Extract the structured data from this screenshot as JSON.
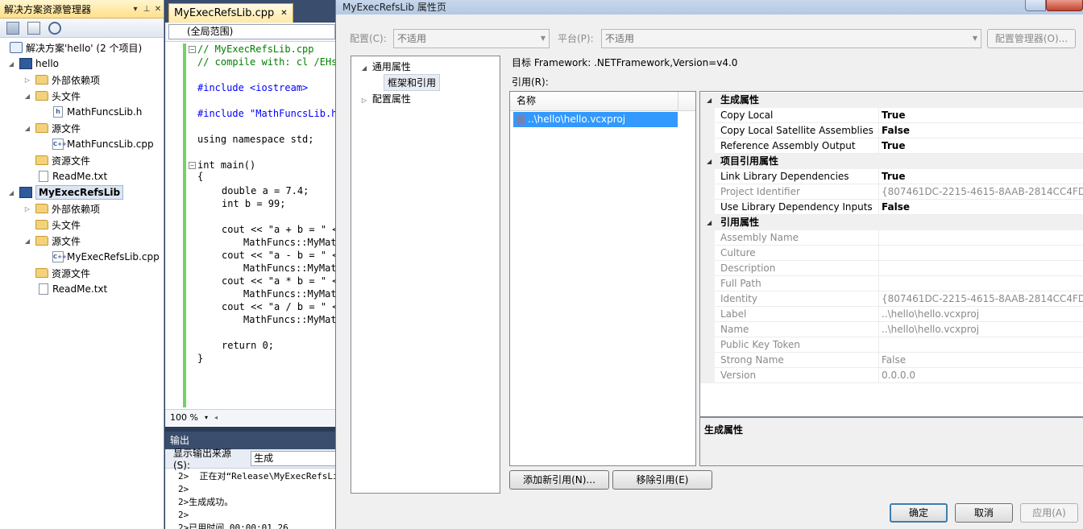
{
  "solution_explorer": {
    "title": "解决方案资源管理器",
    "tree": [
      {
        "label": "解决方案'hello' (2 个项目)",
        "kind": "solution"
      },
      {
        "label": "hello",
        "kind": "project"
      },
      {
        "label": "外部依赖项",
        "kind": "folder"
      },
      {
        "label": "头文件",
        "kind": "folder"
      },
      {
        "label": "MathFuncsLib.h",
        "kind": "header"
      },
      {
        "label": "源文件",
        "kind": "folder"
      },
      {
        "label": "MathFuncsLib.cpp",
        "kind": "cpp"
      },
      {
        "label": "资源文件",
        "kind": "folder"
      },
      {
        "label": "ReadMe.txt",
        "kind": "file"
      },
      {
        "label": "MyExecRefsLib",
        "kind": "project"
      },
      {
        "label": "外部依赖项",
        "kind": "folder"
      },
      {
        "label": "头文件",
        "kind": "folder"
      },
      {
        "label": "源文件",
        "kind": "folder"
      },
      {
        "label": "MyExecRefsLib.cpp",
        "kind": "cpp"
      },
      {
        "label": "资源文件",
        "kind": "folder"
      },
      {
        "label": "ReadMe.txt",
        "kind": "file"
      }
    ]
  },
  "editor": {
    "tab_label": "MyExecRefsLib.cpp",
    "scope": "(全局范围)",
    "zoom": "100 %",
    "lines": [
      "// MyExecRefsLib.cpp",
      "// compile with: cl /EHs",
      "#include <iostream>",
      "#include \"MathFuncsLib.h",
      "using namespace std;",
      "int main()",
      "{",
      "double a = 7.4;",
      "int b = 99;",
      "cout << \"a + b = \" <",
      "MathFuncs::MyMat",
      "cout << \"a - b = \" <",
      "MathFuncs::MyMat",
      "cout << \"a * b = \" <",
      "MathFuncs::MyMat",
      "cout << \"a / b = \" <",
      "MathFuncs::MyMat",
      "return 0;",
      "}"
    ]
  },
  "output": {
    "title": "输出",
    "source_label": "显示输出来源(S):",
    "source_value": "生成",
    "lines": [
      "2>  正在对“Release\\MyExecRefsLil",
      "2>",
      "2>生成成功。",
      "2>",
      "2>已用时间 00:00:01.26"
    ]
  },
  "dialog": {
    "title": "MyExecRefsLib 属性页",
    "config_label": "配置(C):",
    "config_value": "不适用",
    "platform_label": "平台(P):",
    "platform_value": "不适用",
    "config_manager": "配置管理器(O)...",
    "nav": {
      "common": "通用属性",
      "framework": "框架和引用",
      "config": "配置属性"
    },
    "framework_text": "目标 Framework:  .NETFramework,Version=v4.0",
    "refs_label": "引用(R):",
    "list_header": "名称",
    "list_item": "..\\hello\\hello.vcxproj",
    "add_ref": "添加新引用(N)...",
    "remove_ref": "移除引用(E)",
    "ok": "确定",
    "cancel": "取消",
    "apply": "应用(A)",
    "desc_title": "生成属性",
    "properties": [
      {
        "type": "cat",
        "k": "生成属性"
      },
      {
        "type": "row",
        "k": "Copy Local",
        "v": "True",
        "style": "bold"
      },
      {
        "type": "row",
        "k": "Copy Local Satellite Assemblies",
        "v": "False",
        "style": "bold"
      },
      {
        "type": "row",
        "k": "Reference Assembly Output",
        "v": "True",
        "style": "bold"
      },
      {
        "type": "cat",
        "k": "项目引用属性"
      },
      {
        "type": "row",
        "k": "Link Library Dependencies",
        "v": "True",
        "style": "bold"
      },
      {
        "type": "row",
        "k": "Project Identifier",
        "v": "{807461DC-2215-4615-8AAB-2814CC4FD",
        "style": "gray"
      },
      {
        "type": "row",
        "k": "Use Library Dependency Inputs",
        "v": "False",
        "style": "bold"
      },
      {
        "type": "cat",
        "k": "引用属性"
      },
      {
        "type": "row",
        "k": "Assembly Name",
        "v": "",
        "style": "gray"
      },
      {
        "type": "row",
        "k": "Culture",
        "v": "",
        "style": "gray"
      },
      {
        "type": "row",
        "k": "Description",
        "v": "",
        "style": "gray"
      },
      {
        "type": "row",
        "k": "Full Path",
        "v": "",
        "style": "gray"
      },
      {
        "type": "row",
        "k": "Identity",
        "v": "{807461DC-2215-4615-8AAB-2814CC4FD",
        "style": "gray"
      },
      {
        "type": "row",
        "k": "Label",
        "v": "..\\hello\\hello.vcxproj",
        "style": "gray"
      },
      {
        "type": "row",
        "k": "Name",
        "v": "..\\hello\\hello.vcxproj",
        "style": "gray"
      },
      {
        "type": "row",
        "k": "Public Key Token",
        "v": "",
        "style": "gray"
      },
      {
        "type": "row",
        "k": "Strong Name",
        "v": "False",
        "style": "gray"
      },
      {
        "type": "row",
        "k": "Version",
        "v": "0.0.0.0",
        "style": "gray"
      }
    ]
  }
}
